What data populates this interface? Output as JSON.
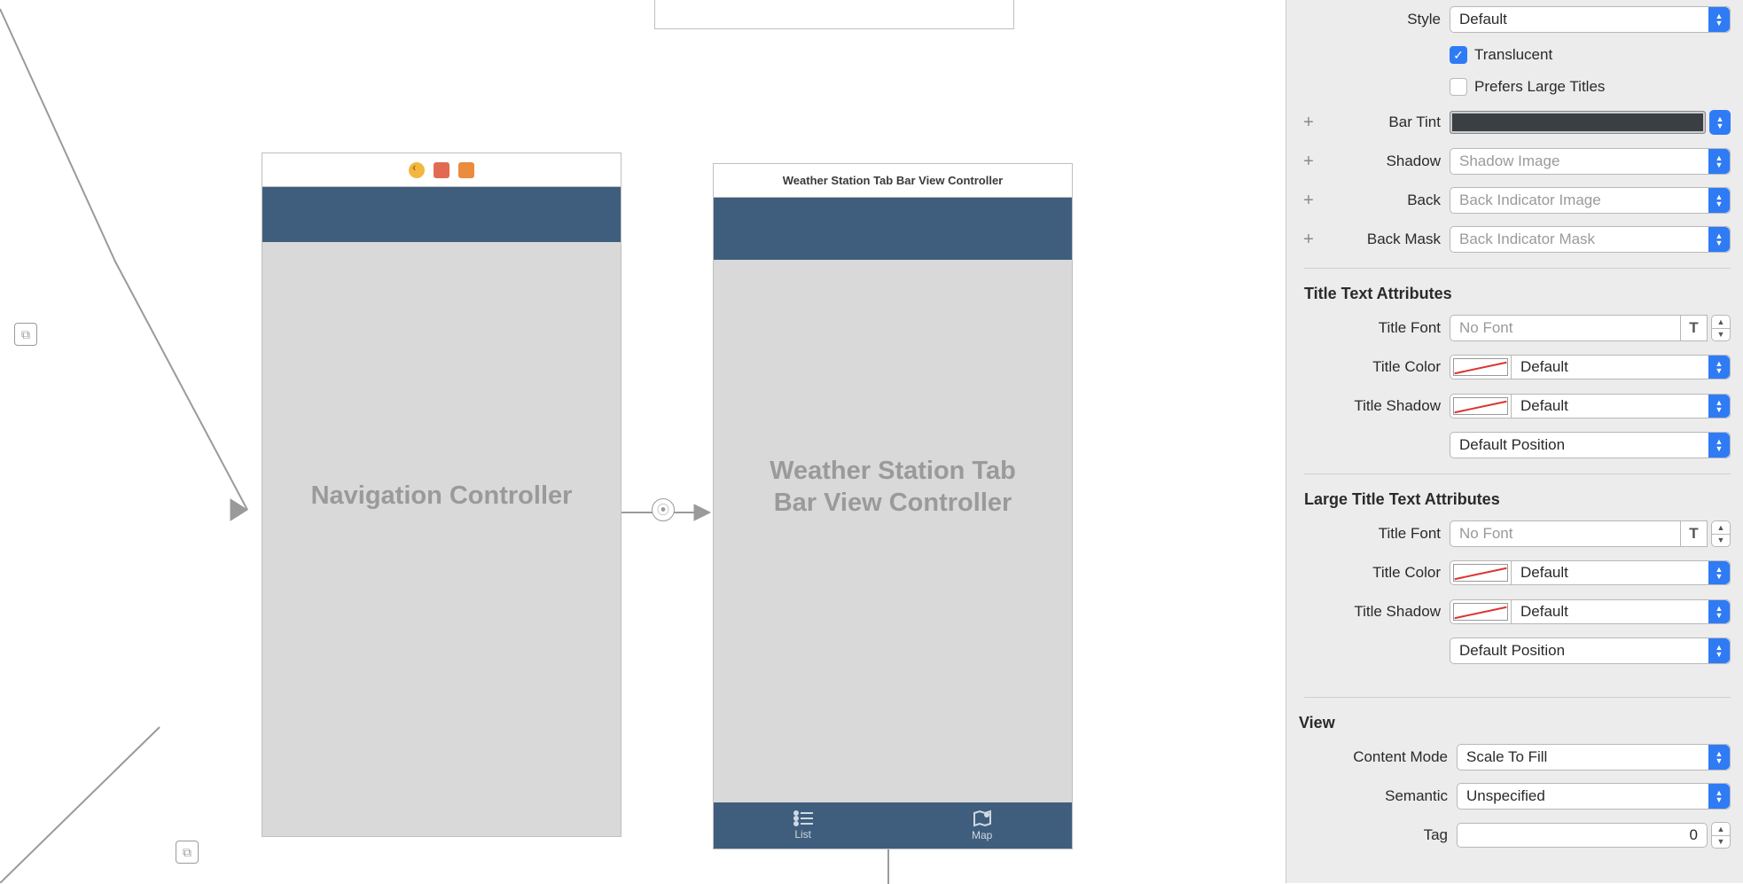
{
  "canvas": {
    "scene1": {
      "title": "Navigation Controller"
    },
    "scene2": {
      "titlebar": "Weather Station Tab Bar View Controller",
      "title": "Weather Station Tab Bar View Controller",
      "tabs": [
        {
          "label": "List"
        },
        {
          "label": "Map"
        }
      ]
    }
  },
  "inspector": {
    "style": {
      "label": "Style",
      "value": "Default"
    },
    "translucent": {
      "label": "Translucent",
      "checked": true
    },
    "prefersLargeTitles": {
      "label": "Prefers Large Titles",
      "checked": false
    },
    "barTint": {
      "label": "Bar Tint",
      "color": "#3a4249"
    },
    "shadow": {
      "label": "Shadow",
      "placeholder": "Shadow Image"
    },
    "back": {
      "label": "Back",
      "placeholder": "Back Indicator Image"
    },
    "backMask": {
      "label": "Back Mask",
      "placeholder": "Back Indicator Mask"
    },
    "titleAttrs": {
      "header": "Title Text Attributes",
      "font": {
        "label": "Title Font",
        "placeholder": "No Font"
      },
      "color": {
        "label": "Title Color",
        "value": "Default"
      },
      "shadow": {
        "label": "Title Shadow",
        "value": "Default"
      },
      "position": {
        "value": "Default Position"
      }
    },
    "largeTitleAttrs": {
      "header": "Large Title Text Attributes",
      "font": {
        "label": "Title Font",
        "placeholder": "No Font"
      },
      "color": {
        "label": "Title Color",
        "value": "Default"
      },
      "shadow": {
        "label": "Title Shadow",
        "value": "Default"
      },
      "position": {
        "value": "Default Position"
      }
    },
    "view": {
      "header": "View",
      "contentMode": {
        "label": "Content Mode",
        "value": "Scale To Fill"
      },
      "semantic": {
        "label": "Semantic",
        "value": "Unspecified"
      },
      "tag": {
        "label": "Tag",
        "value": "0"
      }
    }
  }
}
